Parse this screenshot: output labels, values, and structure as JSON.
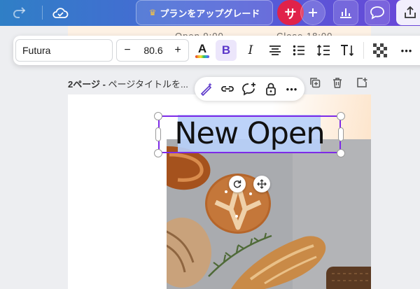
{
  "topbar": {
    "upgrade_label": "プランをアップグレード",
    "avatar_initial": "サ",
    "gradient_start": "#2f7fc6",
    "gradient_end": "#6a45d8"
  },
  "design_peek": {
    "left_text": "Open 9:00",
    "right_text": "Close 18:00"
  },
  "text_toolbar": {
    "font_family": "Futura",
    "font_size": "80.6",
    "minus_label": "−",
    "plus_label": "+",
    "italic_label": "I",
    "bold_label": "B",
    "color_letter": "A",
    "more_label": "•••",
    "active_color": "#ece6fb"
  },
  "page": {
    "label_prefix": "2ページ",
    "label_separator": " - ",
    "title_placeholder": "ページタイトルを..."
  },
  "context_menu": {
    "more_label": "•••"
  },
  "selected_text": {
    "content": "New Open",
    "selection_color": "#7d2ae8",
    "highlight_color": "#b7cff8"
  }
}
